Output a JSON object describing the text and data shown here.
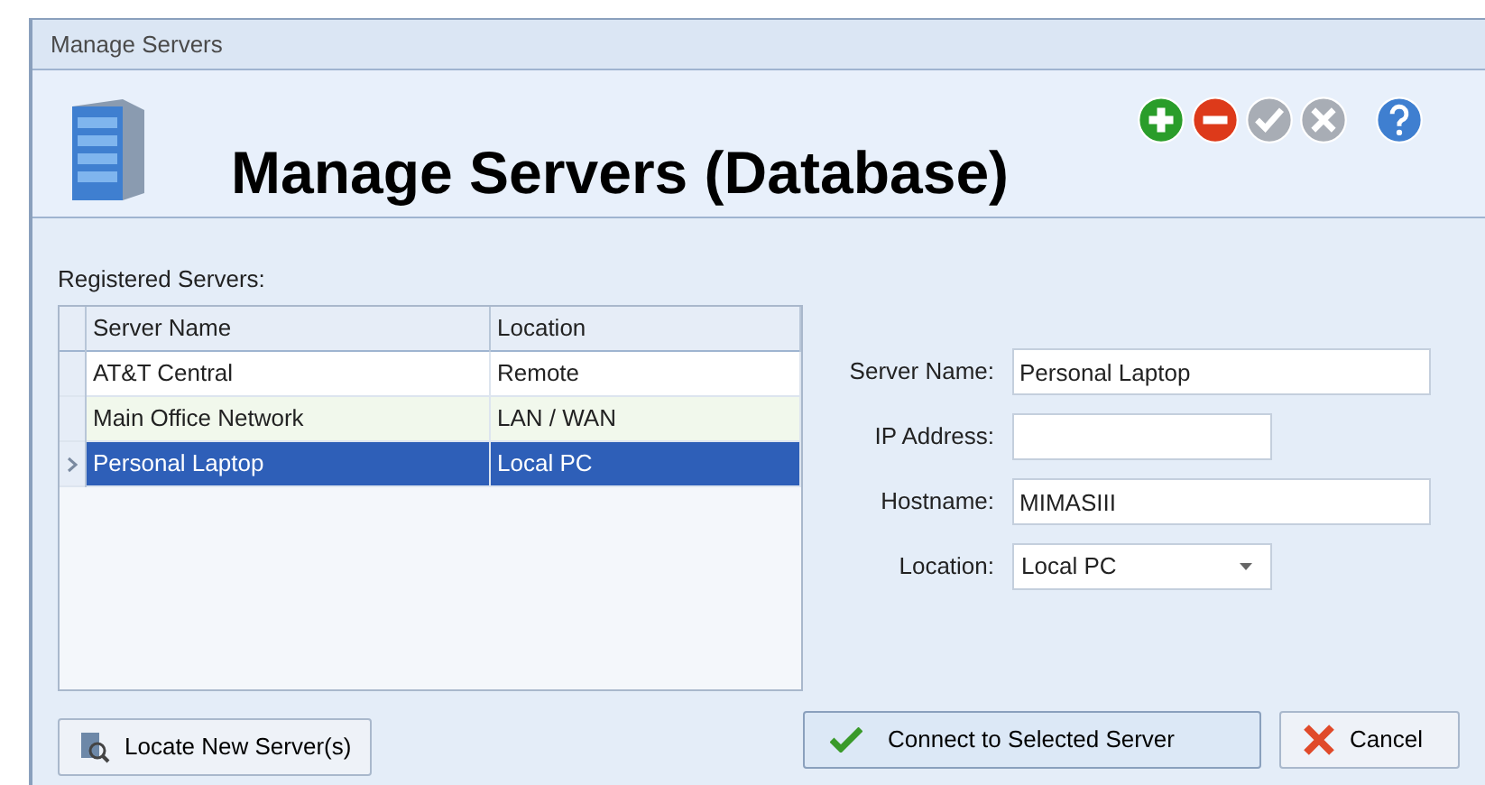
{
  "window": {
    "title": "Manage Servers"
  },
  "header": {
    "title": "Manage Servers (Database)"
  },
  "toolbar": [
    {
      "kind": "add",
      "disabled": false
    },
    {
      "kind": "remove",
      "disabled": false
    },
    {
      "kind": "accept",
      "disabled": true
    },
    {
      "kind": "cancel",
      "disabled": true
    },
    {
      "kind": "help",
      "disabled": false
    }
  ],
  "list": {
    "label": "Registered Servers:",
    "columns": [
      "Server Name",
      "Location"
    ],
    "rows": [
      {
        "cells": [
          "AT&T Central",
          "Remote"
        ],
        "selected": false
      },
      {
        "cells": [
          "Main Office Network",
          "LAN / WAN"
        ],
        "selected": false
      },
      {
        "cells": [
          "Personal Laptop",
          "Local PC"
        ],
        "selected": true
      }
    ]
  },
  "form": [
    {
      "label": "Server Name:",
      "value": "Personal Laptop",
      "kind": "text"
    },
    {
      "label": "IP Address:",
      "kind": "text"
    },
    {
      "label": "Hostname:",
      "value": "MIMASIII",
      "kind": "text"
    },
    {
      "label": "Location:",
      "value": "Local PC",
      "kind": "dropdown"
    }
  ],
  "buttons": {
    "locate": "Locate New Server(s)",
    "connect": "Connect to Selected Server",
    "cancel": "Cancel"
  }
}
